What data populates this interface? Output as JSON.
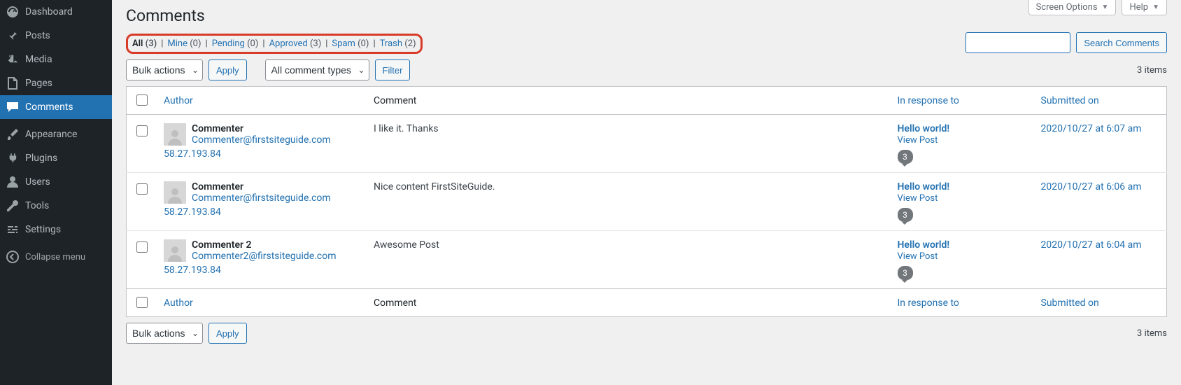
{
  "sidebar": {
    "items": [
      {
        "icon": "dashboard",
        "label": "Dashboard"
      },
      {
        "icon": "pin",
        "label": "Posts"
      },
      {
        "icon": "media",
        "label": "Media"
      },
      {
        "icon": "page",
        "label": "Pages"
      },
      {
        "icon": "comment",
        "label": "Comments",
        "active": true
      },
      {
        "icon": "brush",
        "label": "Appearance"
      },
      {
        "icon": "plug",
        "label": "Plugins"
      },
      {
        "icon": "user",
        "label": "Users"
      },
      {
        "icon": "wrench",
        "label": "Tools"
      },
      {
        "icon": "sliders",
        "label": "Settings"
      }
    ],
    "collapse_label": "Collapse menu"
  },
  "top_tabs": {
    "screen_options": "Screen Options",
    "help": "Help"
  },
  "page": {
    "title": "Comments"
  },
  "filters": {
    "items": [
      {
        "label": "All",
        "count": "(3)",
        "current": true
      },
      {
        "label": "Mine",
        "count": "(0)"
      },
      {
        "label": "Pending",
        "count": "(0)"
      },
      {
        "label": "Approved",
        "count": "(3)"
      },
      {
        "label": "Spam",
        "count": "(0)"
      },
      {
        "label": "Trash",
        "count": "(2)"
      }
    ]
  },
  "search": {
    "button": "Search Comments"
  },
  "bulk": {
    "bulk_actions": "Bulk actions",
    "apply": "Apply",
    "comment_types": "All comment types",
    "filter": "Filter"
  },
  "count_label": "3 items",
  "columns": {
    "author": "Author",
    "comment": "Comment",
    "response": "In response to",
    "date": "Submitted on"
  },
  "rows": [
    {
      "author_name": "Commenter",
      "author_email": "Commenter@firstsiteguide.com",
      "author_ip": "58.27.193.84",
      "comment_text": "I like it. Thanks",
      "response_title": "Hello world!",
      "response_view": "View Post",
      "response_count": "3",
      "submitted": "2020/10/27 at 6:07 am"
    },
    {
      "author_name": "Commenter",
      "author_email": "Commenter@firstsiteguide.com",
      "author_ip": "58.27.193.84",
      "comment_text": "Nice content FirstSiteGuide.",
      "response_title": "Hello world!",
      "response_view": "View Post",
      "response_count": "3",
      "submitted": "2020/10/27 at 6:06 am"
    },
    {
      "author_name": "Commenter 2",
      "author_email": "Commenter2@firstsiteguide.com",
      "author_ip": "58.27.193.84",
      "comment_text": "Awesome Post",
      "response_title": "Hello world!",
      "response_view": "View Post",
      "response_count": "3",
      "submitted": "2020/10/27 at 6:04 am"
    }
  ]
}
